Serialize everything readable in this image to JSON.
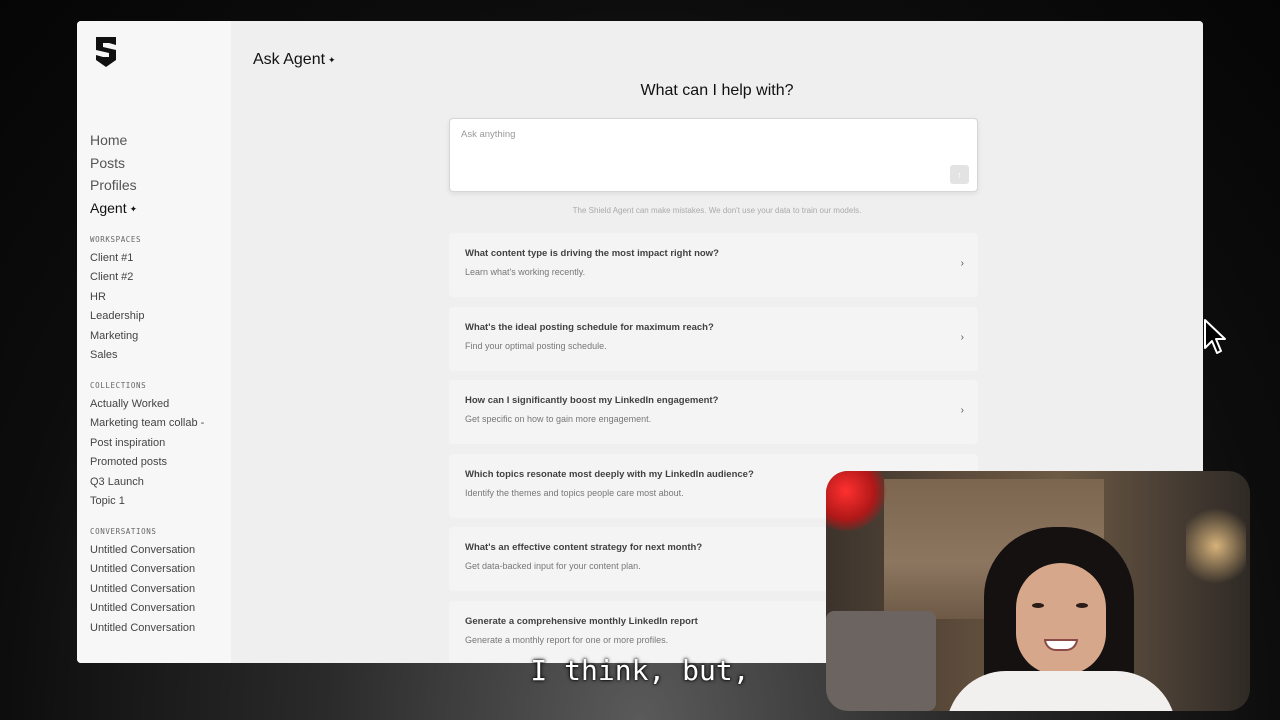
{
  "sidebar": {
    "nav": [
      {
        "label": "Home"
      },
      {
        "label": "Posts"
      },
      {
        "label": "Profiles"
      },
      {
        "label": "Agent"
      }
    ],
    "workspaces_heading": "WORKSPACES",
    "workspaces": [
      "Client #1",
      "Client #2",
      "HR",
      "Leadership",
      "Marketing",
      "Sales"
    ],
    "collections_heading": "COLLECTIONS",
    "collections": [
      "Actually Worked",
      "Marketing team collab -",
      "Post inspiration",
      "Promoted posts",
      "Q3 Launch",
      "Topic 1"
    ],
    "conversations_heading": "CONVERSATIONS",
    "conversations": [
      "Untitled Conversation",
      "Untitled Conversation",
      "Untitled Conversation",
      "Untitled Conversation",
      "Untitled Conversation"
    ]
  },
  "main": {
    "page_title": "Ask Agent",
    "headline": "What can I help with?",
    "prompt_placeholder": "Ask anything",
    "disclaimer": "The Shield Agent can make mistakes. We don't use your data to train our models.",
    "suggestions": [
      {
        "title": "What content type is driving the most impact right now?",
        "subtitle": "Learn what's working recently."
      },
      {
        "title": "What's the ideal posting schedule for maximum reach?",
        "subtitle": "Find your optimal posting schedule."
      },
      {
        "title": "How can I significantly boost my LinkedIn engagement?",
        "subtitle": "Get specific on how to gain more engagement."
      },
      {
        "title": "Which topics resonate most deeply with my LinkedIn audience?",
        "subtitle": "Identify the themes and topics people care most about."
      },
      {
        "title": "What's an effective content strategy for next month?",
        "subtitle": "Get data-backed input for your content plan."
      },
      {
        "title": "Generate a comprehensive monthly LinkedIn report",
        "subtitle": "Generate a monthly report for one or more profiles."
      }
    ]
  },
  "overlay": {
    "caption": "I think, but,"
  },
  "icons": {
    "logo": "shield-logo-icon",
    "sparkle": "sparkle-icon",
    "chevron": "chevron-right-icon",
    "send": "arrow-up-icon",
    "cursor": "mouse-pointer-icon"
  }
}
